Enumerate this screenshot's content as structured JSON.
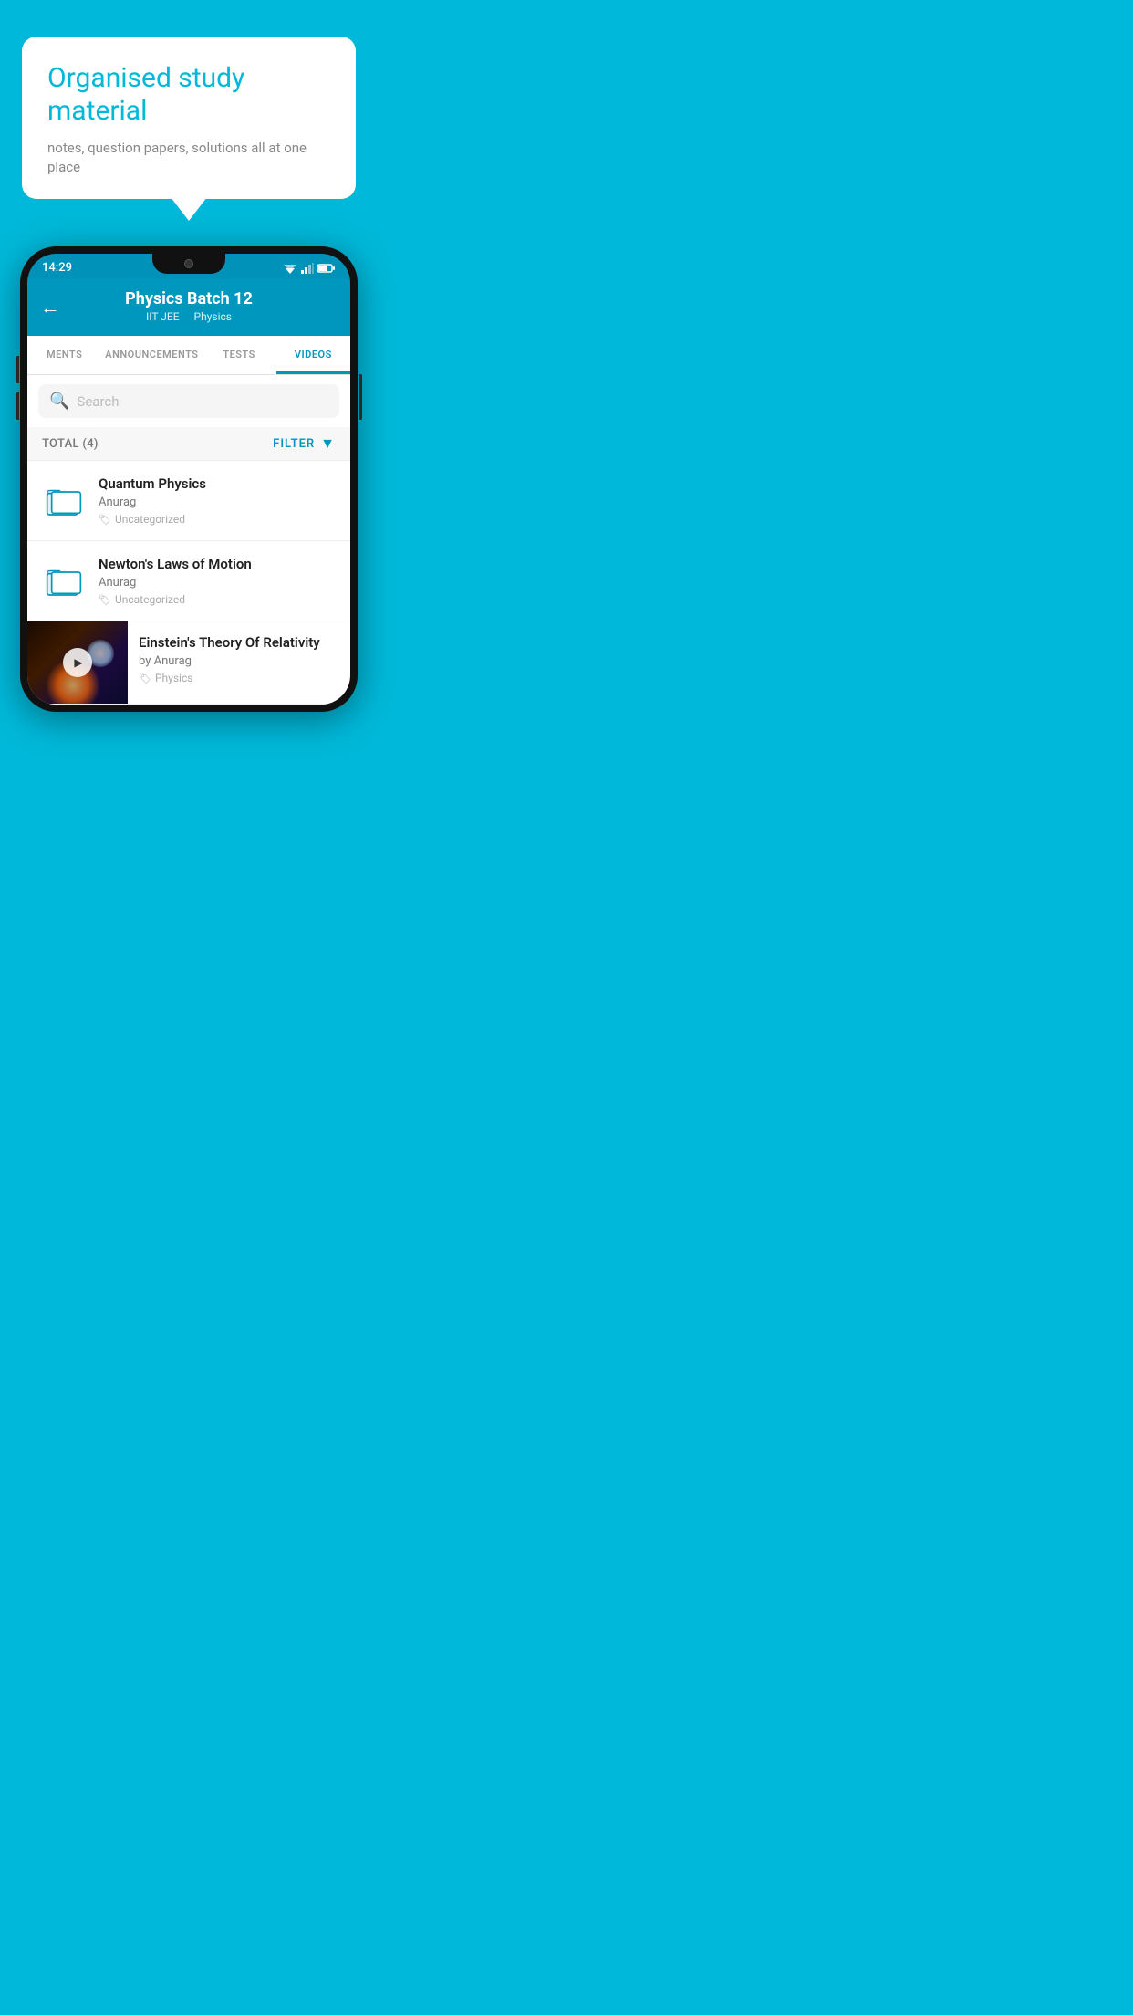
{
  "bubble": {
    "title": "Organised study material",
    "subtitle": "notes, question papers, solutions all at one place"
  },
  "phone": {
    "status_time": "14:29",
    "header": {
      "title": "Physics Batch 12",
      "tags": [
        "IIT JEE",
        "Physics"
      ],
      "back_label": "←"
    },
    "tabs": [
      {
        "label": "MENTS",
        "active": false
      },
      {
        "label": "ANNOUNCEMENTS",
        "active": false
      },
      {
        "label": "TESTS",
        "active": false
      },
      {
        "label": "VIDEOS",
        "active": true
      }
    ],
    "search": {
      "placeholder": "Search"
    },
    "filter": {
      "total_label": "TOTAL (4)",
      "filter_label": "FILTER"
    },
    "videos": [
      {
        "title": "Quantum Physics",
        "author": "Anurag",
        "category": "Uncategorized",
        "type": "folder"
      },
      {
        "title": "Newton's Laws of Motion",
        "author": "Anurag",
        "category": "Uncategorized",
        "type": "folder"
      },
      {
        "title": "Einstein's Theory Of Relativity",
        "author": "by Anurag",
        "category": "Physics",
        "type": "video"
      }
    ]
  }
}
